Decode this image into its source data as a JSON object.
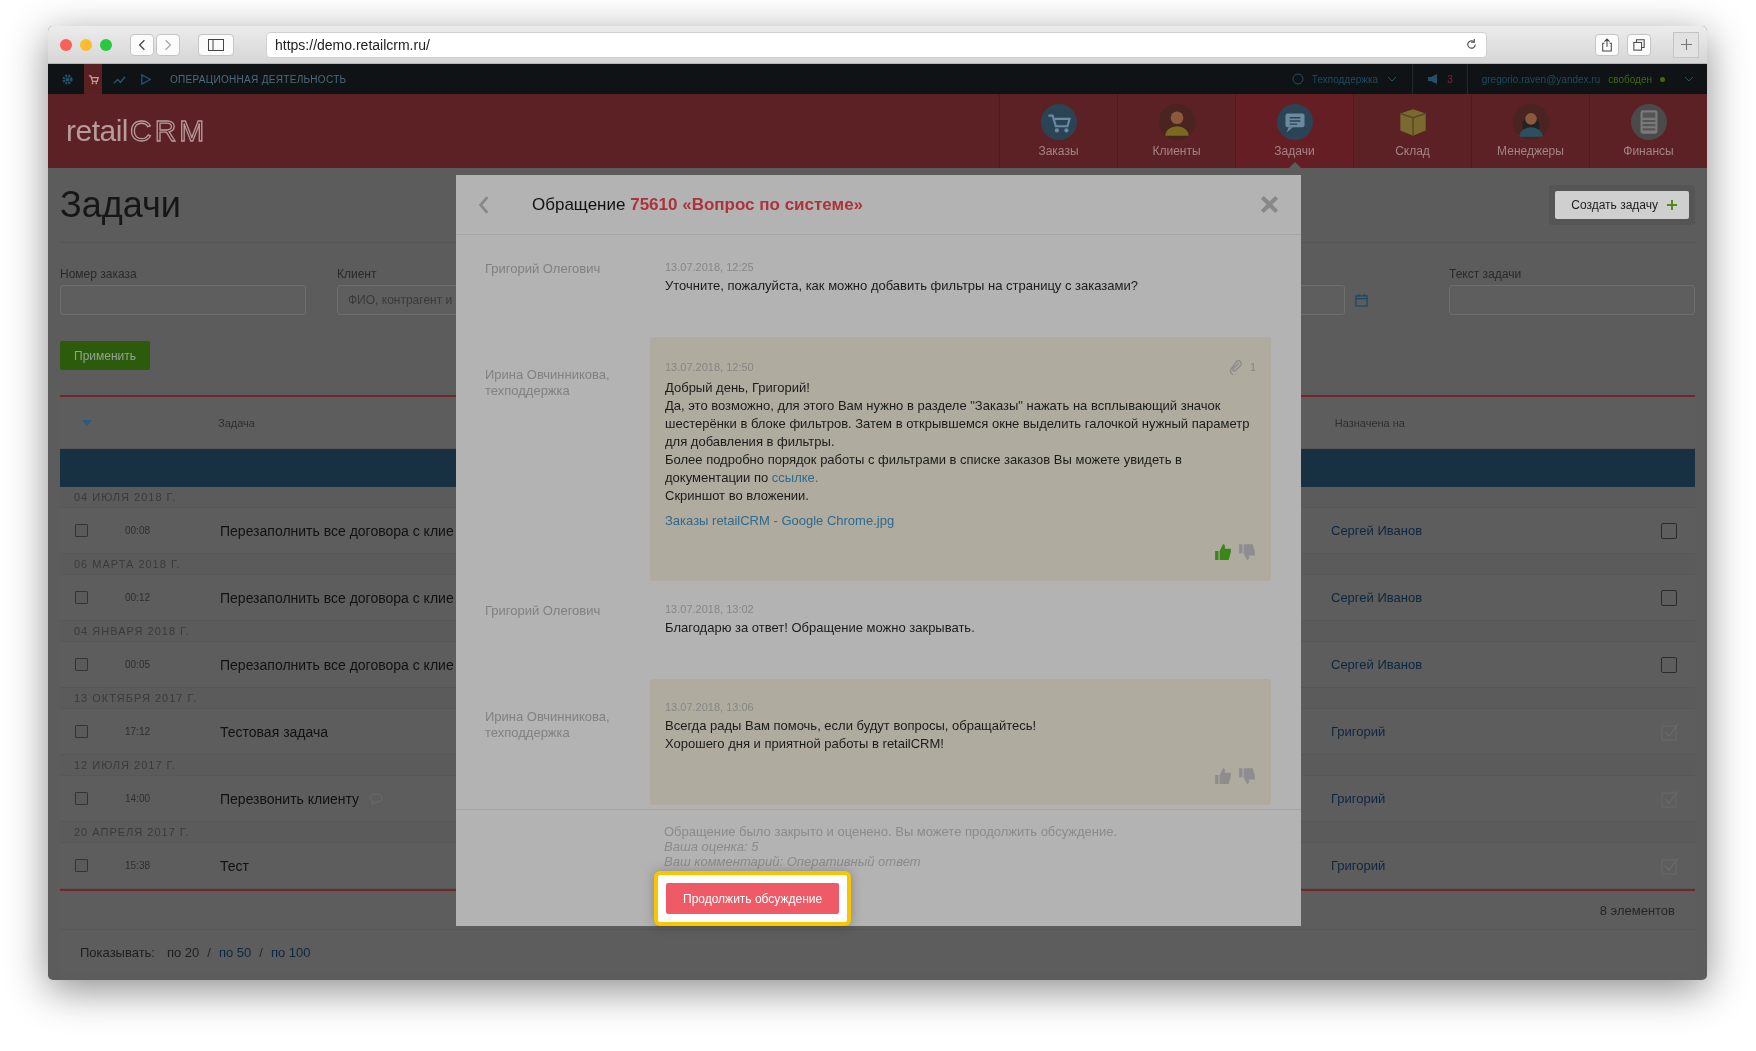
{
  "browser": {
    "url": "https://demo.retailcrm.ru/"
  },
  "top_bar": {
    "section_icons": [
      {
        "selected": false
      },
      {
        "selected": true
      },
      {
        "selected": false
      },
      {
        "selected": false
      }
    ],
    "section": "ОПЕРАЦИОННАЯ ДЕЯТЕЛЬНОСТЬ",
    "support": "Техподдержка",
    "notifications": "3",
    "user": "gregorio.raven@yandex.ru",
    "status": "свободен"
  },
  "header": {
    "logo": "retail",
    "logo_accent": "CRM",
    "nav": [
      {
        "label": "Заказы",
        "selected": false
      },
      {
        "label": "Клиенты",
        "selected": false
      },
      {
        "label": "Задачи",
        "selected": true
      },
      {
        "label": "Склад",
        "selected": false
      },
      {
        "label": "Менеджеры",
        "selected": false
      },
      {
        "label": "Финансы",
        "selected": false
      }
    ]
  },
  "page": {
    "title": "Задачи",
    "create_button": "Создать задачу",
    "apply_button": "Применить",
    "filters_left": [
      {
        "label": "Номер заказа"
      },
      {
        "label": "Клиент",
        "placeholder": "ФИО, контрагент и"
      }
    ],
    "filters_right": [
      {
        "kind": "date"
      },
      {
        "kind": "text",
        "label": "Текст задачи"
      }
    ]
  },
  "table": {
    "columns": [
      "Задача",
      "Назначена на"
    ],
    "groups": [
      {
        "date": "04 ИЮЛЯ 2018 Г.",
        "tasks": [
          {
            "checked": false,
            "time": "00:08",
            "title": "Перезаполнить все договора с клие",
            "has_comment": false,
            "assignee": "Сергей Иванов",
            "done": false
          }
        ]
      },
      {
        "date": "06 МАРТА 2018 Г.",
        "tasks": [
          {
            "checked": false,
            "time": "00:12",
            "title": "Перезаполнить все договора с клие",
            "has_comment": false,
            "assignee": "Сергей Иванов",
            "done": false
          }
        ]
      },
      {
        "date": "04 ЯНВАРЯ 2018 Г.",
        "tasks": [
          {
            "checked": false,
            "time": "00:05",
            "title": "Перезаполнить все договора с клие",
            "has_comment": false,
            "assignee": "Сергей Иванов",
            "done": false
          }
        ]
      },
      {
        "date": "13 ОКТЯБРЯ 2017 Г.",
        "tasks": [
          {
            "checked": false,
            "time": "17:12",
            "title": "Тестовая задача",
            "has_comment": false,
            "assignee": "Григорий",
            "done": true
          }
        ]
      },
      {
        "date": "12 ИЮЛЯ 2017 Г.",
        "tasks": [
          {
            "checked": false,
            "time": "14:00",
            "title": "Перезвонить клиенту",
            "has_comment": true,
            "assignee": "Григорий",
            "done": true
          }
        ]
      },
      {
        "date": "20 АПРЕЛЯ 2017 Г.",
        "tasks": [
          {
            "checked": false,
            "time": "15:38",
            "title": "Тест",
            "has_comment": false,
            "assignee": "Григорий",
            "done": true
          }
        ]
      }
    ],
    "total": "8 элементов"
  },
  "pagination": {
    "label": "Показывать:",
    "separator": "/",
    "options": [
      {
        "label": "по 20",
        "selected": true
      },
      {
        "label": "по 50",
        "selected": false
      },
      {
        "label": "по 100",
        "selected": false
      }
    ]
  },
  "modal": {
    "title": "Обращение",
    "number": "75610",
    "subject": "«Вопрос по системе»",
    "messages": [
      {
        "kind": "client",
        "author": "Григорий Олегович",
        "time": "13.07.2018, 12:25",
        "paragraphs": [
          {
            "text": "Уточните, пожалуйста, как можно добавить фильтры на страницу с заказами?"
          }
        ]
      },
      {
        "kind": "support",
        "author": "Ирина Овчинникова, техподдержка",
        "time": "13.07.2018, 12:50",
        "attachments": "1",
        "paragraphs": [
          {
            "text": "Добрый день, Григорий!"
          },
          {
            "text": "Да, это возможно, для этого Вам нужно в разделе \"Заказы\" нажать на всплывающий значок шестерёнки в блоке фильтров. Затем в открывшемся окне выделить галочкой нужный параметр для добавления в фильтры."
          },
          {
            "text": "Более подробно порядок работы с фильтрами в списке заказов Вы можете увидеть в документации по ",
            "link": "ссылке."
          },
          {
            "text": "Скриншот во вложении."
          }
        ],
        "file": "Заказы retailCRM - Google Chrome.jpg",
        "liked": true,
        "disliked": false
      },
      {
        "kind": "client",
        "author": "Григорий Олегович",
        "time": "13.07.2018, 13:02",
        "paragraphs": [
          {
            "text": "Благодарю за ответ! Обращение можно закрывать."
          }
        ]
      },
      {
        "kind": "support",
        "author": "Ирина Овчинникова, техподдержка",
        "time": "13.07.2018, 13:06",
        "paragraphs": [
          {
            "text": "Всегда рады Вам помочь, если будут вопросы, обращайтесь!"
          },
          {
            "text": "Хорошего дня и приятной работы в retailCRM!"
          }
        ],
        "liked": false,
        "disliked": false
      }
    ],
    "closed_note": "Обращение было закрыто и оценено. Вы можете продолжить обсуждение.",
    "rating": "Ваша оценка: 5",
    "comment": "Ваш комментарий: Оперативный ответ",
    "button": "Продолжить обсуждение",
    "button_highlighted": true
  }
}
